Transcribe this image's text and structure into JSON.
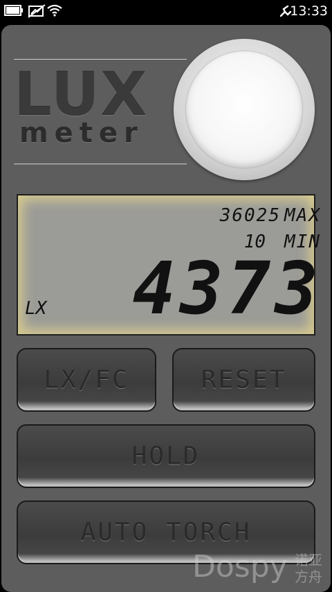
{
  "status_bar": {
    "time": "13:33",
    "icons": [
      "battery-icon",
      "no-sim-icon",
      "wifi-icon",
      "usb-debug-icon"
    ]
  },
  "logo": {
    "line1": "LUX",
    "line2": "meter"
  },
  "display": {
    "max_value": "36025",
    "max_label": "MAX",
    "min_value": "10",
    "min_label": "MIN",
    "reading": "4373",
    "unit": "LX",
    "backlight_color": "#d9cc8e"
  },
  "buttons": {
    "lxfc": "LX/FC",
    "reset": "RESET",
    "hold": "HOLD",
    "auto_torch": "AUTO TORCH"
  },
  "watermark": {
    "latin": "Dospy",
    "cjk_line1": "诺亚",
    "cjk_line2": "方舟"
  }
}
